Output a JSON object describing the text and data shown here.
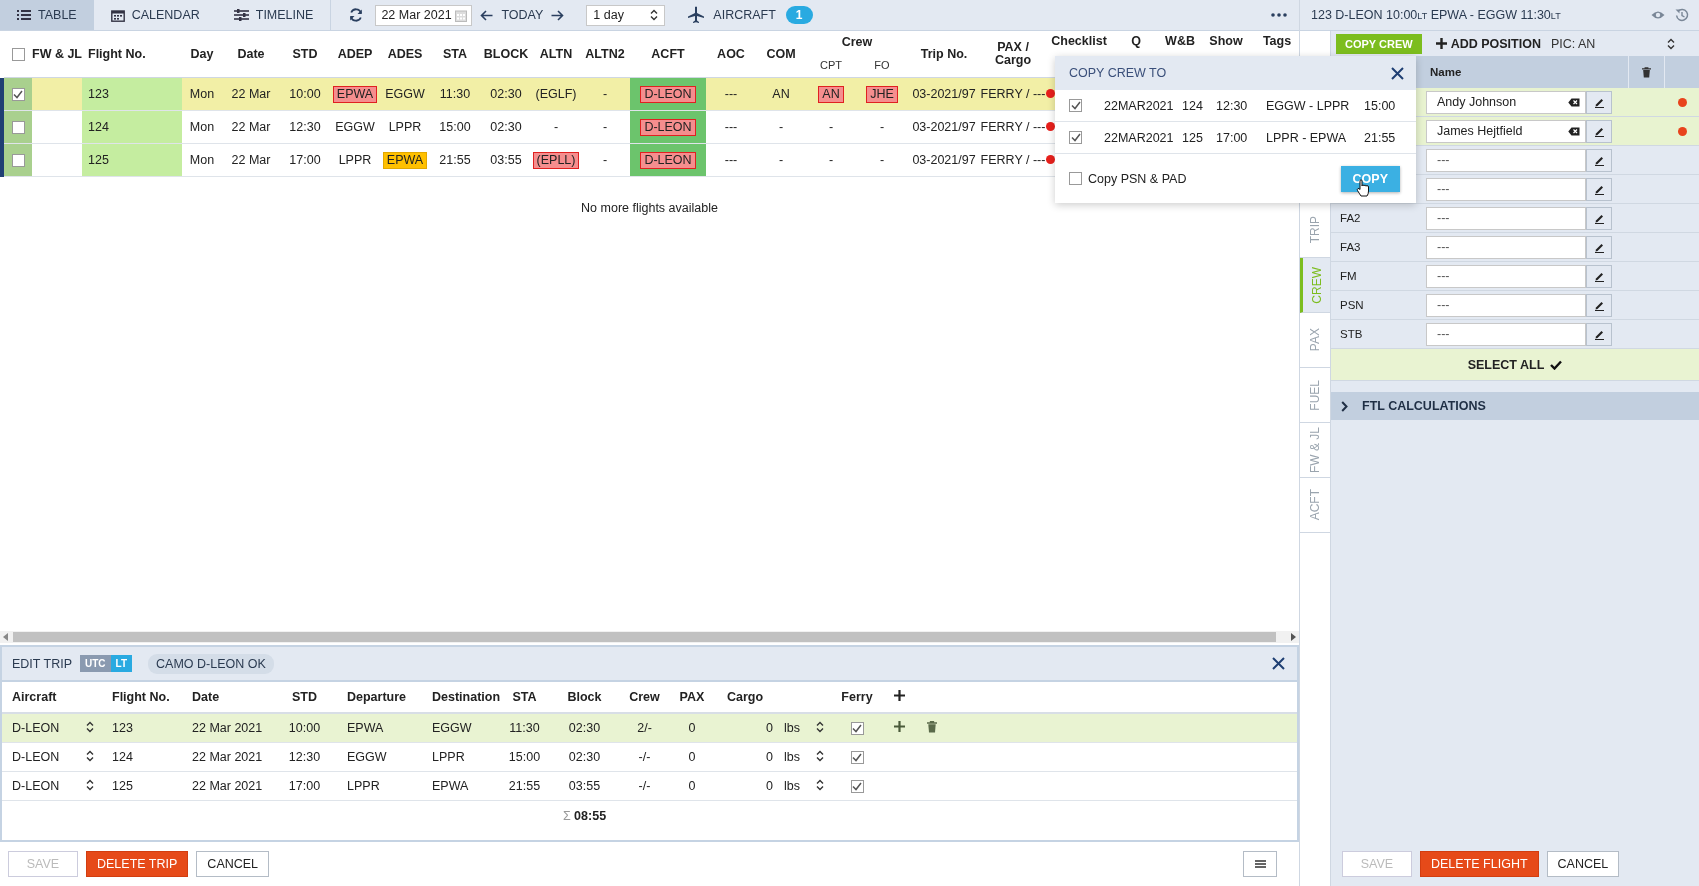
{
  "view_tabs": [
    {
      "label": "TABLE",
      "selected": true
    },
    {
      "label": "CALENDAR",
      "selected": false
    },
    {
      "label": "TIMELINE",
      "selected": false
    }
  ],
  "date_field": {
    "value": "22 Mar 2021"
  },
  "today_button": "TODAY",
  "range_select": {
    "value": "1 day"
  },
  "aircraft_filter": {
    "label": "AIRCRAFT",
    "count": "1"
  },
  "flight_table": {
    "select_all": false,
    "columns": [
      {
        "label": "FW & JL"
      },
      {
        "label": "Flight No."
      },
      {
        "label": "Day"
      },
      {
        "label": "Date"
      },
      {
        "label": "STD"
      },
      {
        "label": "ADEP"
      },
      {
        "label": "ADES"
      },
      {
        "label": "STA"
      },
      {
        "label": "BLOCK"
      },
      {
        "label": "ALTN"
      },
      {
        "label": "ALTN2"
      },
      {
        "label": "ACFT"
      },
      {
        "label": "AOC"
      },
      {
        "label": "COM"
      },
      {
        "label": "Crew",
        "colspan": 2,
        "subs": [
          "CPT",
          "FO"
        ]
      },
      {
        "label": "Trip No."
      },
      {
        "label": "PAX / Cargo"
      },
      {
        "label": "Checklist"
      },
      {
        "label": "Q"
      },
      {
        "label": "W&B"
      },
      {
        "label": "Show"
      },
      {
        "label": "Tags"
      }
    ],
    "rows": [
      {
        "selected": true,
        "cells": [
          {
            "text": ""
          },
          {
            "text": "123"
          },
          {
            "text": "Mon"
          },
          {
            "text": "22 Mar"
          },
          {
            "text": "10:00"
          },
          {
            "text": "EPWA",
            "kind": "alert"
          },
          {
            "text": "EGGW"
          },
          {
            "text": "11:30"
          },
          {
            "text": "02:30"
          },
          {
            "text": "(EGLF)"
          },
          {
            "text": "-"
          },
          {
            "text": "D-LEON",
            "kind": "alert"
          },
          {
            "text": "---"
          },
          {
            "text": "AN"
          },
          {
            "text": "AN",
            "kind": "alert"
          },
          {
            "text": "JHE",
            "kind": "alert"
          },
          {
            "text": "03-2021/97"
          },
          {
            "text": "FERRY / ---"
          }
        ],
        "checklist": {
          "color": "#e8201c"
        }
      },
      {
        "selected": false,
        "cells": [
          {
            "text": ""
          },
          {
            "text": "124"
          },
          {
            "text": "Mon"
          },
          {
            "text": "22 Mar"
          },
          {
            "text": "12:30"
          },
          {
            "text": "EGGW"
          },
          {
            "text": "LPPR"
          },
          {
            "text": "15:00"
          },
          {
            "text": "02:30"
          },
          {
            "text": "-"
          },
          {
            "text": "-"
          },
          {
            "text": "D-LEON",
            "kind": "alert"
          },
          {
            "text": "---"
          },
          {
            "text": "-"
          },
          {
            "text": "-"
          },
          {
            "text": "-"
          },
          {
            "text": "03-2021/97"
          },
          {
            "text": "FERRY / ---"
          }
        ],
        "checklist": {
          "color": "#e8201c"
        }
      },
      {
        "selected": false,
        "cells": [
          {
            "text": ""
          },
          {
            "text": "125"
          },
          {
            "text": "Mon"
          },
          {
            "text": "22 Mar"
          },
          {
            "text": "17:00"
          },
          {
            "text": "LPPR"
          },
          {
            "text": "EPWA",
            "kind": "warning"
          },
          {
            "text": "21:55"
          },
          {
            "text": "03:55"
          },
          {
            "text": "(EPLL)",
            "kind": "alert"
          },
          {
            "text": "-"
          },
          {
            "text": "D-LEON",
            "kind": "alert"
          },
          {
            "text": "---"
          },
          {
            "text": "-"
          },
          {
            "text": "-"
          },
          {
            "text": "-"
          },
          {
            "text": "03-2021/97"
          },
          {
            "text": "FERRY / ---"
          }
        ],
        "checklist": {
          "color": "#e8201c"
        }
      }
    ],
    "footer": "No more flights available"
  },
  "copy_crew_popup": {
    "title": "COPY CREW TO",
    "flights": [
      {
        "checked": true,
        "date": "22MAR2021",
        "flight_no": "124",
        "std": "12:30",
        "route": "EGGW - LPPR",
        "sta": "15:00"
      },
      {
        "checked": true,
        "date": "22MAR2021",
        "flight_no": "125",
        "std": "17:00",
        "route": "LPPR - EPWA",
        "sta": "21:55"
      }
    ],
    "copy_psn_pad": {
      "label": "Copy PSN & PAD",
      "checked": false
    },
    "copy_button": "COPY"
  },
  "edit_trip": {
    "title": "EDIT TRIP",
    "time_toggle": [
      {
        "label": "UTC",
        "selected": false
      },
      {
        "label": "LT",
        "selected": true
      }
    ],
    "camo_status": "CAMO D-LEON OK",
    "columns": [
      "Aircraft",
      "Flight No.",
      "Date",
      "STD",
      "Departure",
      "Destination",
      "STA",
      "Block",
      "Crew",
      "PAX",
      "Cargo",
      "Ferry"
    ],
    "rows": [
      {
        "selected": true,
        "aircraft": "D-LEON",
        "flight_no": "123",
        "date": "22 Mar 2021",
        "std": "10:00",
        "departure": "EPWA",
        "destination": "EGGW",
        "sta": "11:30",
        "block": "02:30",
        "crew": "2/-",
        "pax": "0",
        "cargo": "0",
        "unit": "lbs",
        "ferry": true
      },
      {
        "selected": false,
        "aircraft": "D-LEON",
        "flight_no": "124",
        "date": "22 Mar 2021",
        "std": "12:30",
        "departure": "EGGW",
        "destination": "LPPR",
        "sta": "15:00",
        "block": "02:30",
        "crew": "-/-",
        "pax": "0",
        "cargo": "0",
        "unit": "lbs",
        "ferry": true
      },
      {
        "selected": false,
        "aircraft": "D-LEON",
        "flight_no": "125",
        "date": "22 Mar 2021",
        "std": "17:00",
        "departure": "LPPR",
        "destination": "EPWA",
        "sta": "21:55",
        "block": "03:55",
        "crew": "-/-",
        "pax": "0",
        "cargo": "0",
        "unit": "lbs",
        "ferry": true
      }
    ],
    "total": {
      "symbol": "Σ",
      "value": "08:55"
    }
  },
  "trip_buttons": [
    {
      "label": "SAVE",
      "kind": "plain",
      "disabled": true
    },
    {
      "label": "DELETE TRIP",
      "kind": "danger",
      "disabled": false
    },
    {
      "label": "CANCEL",
      "kind": "plain",
      "disabled": false
    }
  ],
  "flight_header": {
    "title": "123 D-LEON 10:00$_{LT}$ EPWA - EGGW 11:30$_{LT}$"
  },
  "side_tabs": [
    {
      "label": "TRIP",
      "selected": false
    },
    {
      "label": "CREW",
      "selected": true
    },
    {
      "label": "PAX",
      "selected": false
    },
    {
      "label": "FUEL",
      "selected": false
    },
    {
      "label": "FW & JL",
      "selected": false
    },
    {
      "label": "ACFT",
      "selected": false
    }
  ],
  "crew_panel": {
    "copy_crew_button": "COPY CREW",
    "add_position_button": "ADD POSITION",
    "pic": "PIC: AN",
    "name_header": "Name",
    "positions": [
      {
        "value": "Andy Johnson",
        "selected": true,
        "color": "#e8431c"
      },
      {
        "value": "James Hejtfield",
        "selected": true,
        "color": "#e8431c"
      },
      {
        "placeholder": "---",
        "selected": false
      },
      {
        "placeholder": "---",
        "selected": false
      },
      {
        "label": "FA2",
        "placeholder": "---",
        "selected": false
      },
      {
        "label": "FA3",
        "placeholder": "---",
        "selected": false
      },
      {
        "label": "FM",
        "placeholder": "---",
        "selected": false
      },
      {
        "label": "PSN",
        "placeholder": "---",
        "selected": false
      },
      {
        "label": "STB",
        "placeholder": "---",
        "selected": false
      }
    ],
    "select_all": "SELECT ALL",
    "ftl": {
      "label": "FTL CALCULATIONS",
      "expanded": false
    }
  },
  "flight_buttons": [
    {
      "label": "SAVE",
      "kind": "plain",
      "disabled": true
    },
    {
      "label": "DELETE FLIGHT",
      "kind": "danger",
      "disabled": false
    },
    {
      "label": "CANCEL",
      "kind": "plain",
      "disabled": false
    }
  ]
}
